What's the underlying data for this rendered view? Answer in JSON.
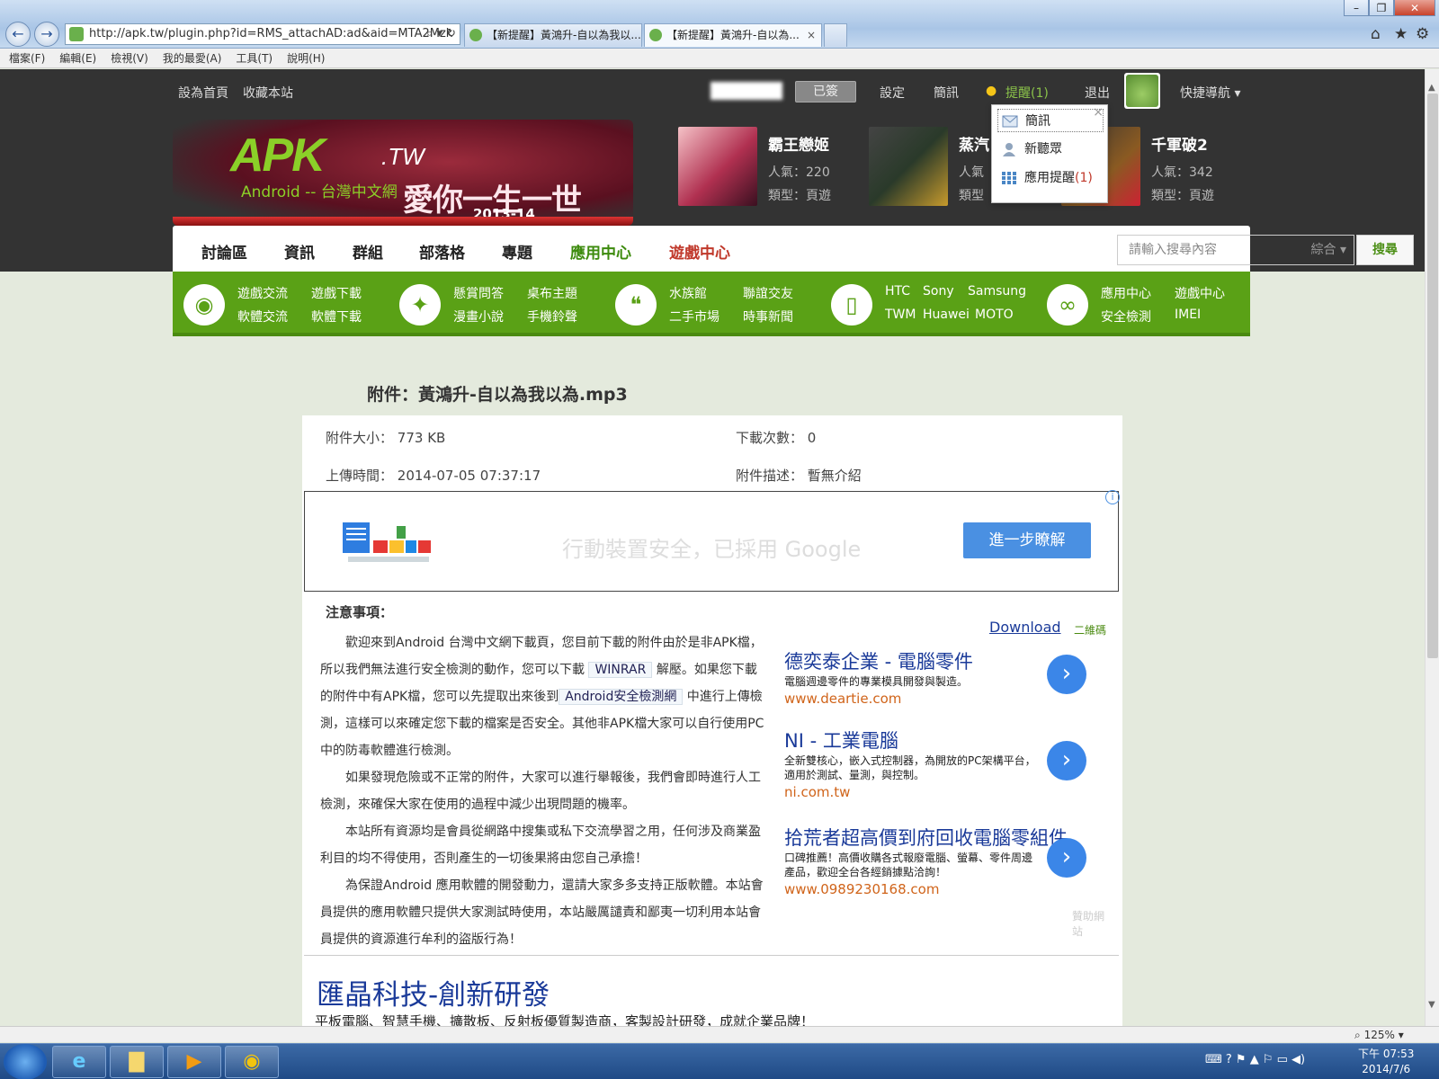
{
  "browser": {
    "url": "http://apk.tw/plugin.php?id=RMS_attachAD:ad&aid=MTA2Mzk",
    "tabs": [
      {
        "label": "【新提醒】黃鴻升-自以為我以..."
      },
      {
        "label": "【新提醒】黃鴻升-自以為..."
      }
    ],
    "tab_close": "×",
    "menu": [
      "檔案(F)",
      "編輯(E)",
      "檢視(V)",
      "我的最愛(A)",
      "工具(T)",
      "說明(H)"
    ],
    "zoom": "125%"
  },
  "topbar": {
    "set_home": "設為首頁",
    "bookmark": "收藏本站",
    "signed": "已簽",
    "settings": "設定",
    "messages": "簡訊",
    "remind": "提醒(1)",
    "logout": "退出",
    "quick_nav": "快捷導航"
  },
  "dropdown": {
    "items": [
      {
        "label": "簡訊",
        "icon": "mail-icon"
      },
      {
        "label": "新聽眾",
        "icon": "user-icon"
      },
      {
        "label": "應用提醒",
        "count": "(1)",
        "icon": "grid-icon"
      }
    ],
    "close": "×"
  },
  "logo": {
    "apk": "APK",
    "tw": ".TW",
    "sub": "Android -- 台灣中文網",
    "love": "愛你一生一世",
    "year": "2013-14"
  },
  "games": [
    {
      "name": "霸王戀姬",
      "popularity": "人氣：220",
      "type": "類型：頁遊"
    },
    {
      "name": "蒸汽",
      "popularity": "人氣",
      "type": "類型"
    },
    {
      "name": "千軍破2",
      "popularity": "人氣：342",
      "type": "類型：頁遊"
    }
  ],
  "mainnav": {
    "items": [
      "討論區",
      "資訊",
      "群組",
      "部落格",
      "專題",
      "應用中心",
      "遊戲中心"
    ],
    "search_placeholder": "請輸入搜尋內容",
    "search_scope": "綜合",
    "search_button": "搜尋"
  },
  "catbar": {
    "groups": [
      {
        "icon": "android-icon",
        "links": [
          "遊戲交流",
          "遊戲下載",
          "軟體交流",
          "軟體下載"
        ]
      },
      {
        "icon": "wand-icon",
        "links": [
          "懸賞問答",
          "桌布主題",
          "漫畫小說",
          "手機鈴聲"
        ]
      },
      {
        "icon": "chat-icon",
        "links": [
          "水族館",
          "聯誼交友",
          "二手市場",
          "時事新聞"
        ]
      },
      {
        "icon": "phone-icon",
        "links": [
          "HTC",
          "Sony",
          "Samsung",
          "TWM",
          "Huawei",
          "MOTO"
        ]
      },
      {
        "icon": "link-icon",
        "links": [
          "應用中心",
          "遊戲中心",
          "安全檢測",
          "IMEI"
        ]
      }
    ]
  },
  "attachment": {
    "title": "附件：黃鴻升-自以為我以為.mp3",
    "size_label": "附件大小：",
    "size": "773 KB",
    "downloads_label": "下載次數：",
    "downloads": "0",
    "upload_label": "上傳時間：",
    "upload_time": "2014-07-05 07:37:17",
    "desc_label": "附件描述：",
    "desc": "暫無介紹"
  },
  "banner": {
    "text": "行動裝置安全，已採用 Google",
    "button": "進一步瞭解",
    "info": "i"
  },
  "notice": {
    "title": "注意事項：",
    "p1_a": "歡迎來到Android 台灣中文網下載頁，您目前下載的附件由於是非APK檔，所以我們無法進行安全檢測的動作，您可以下載",
    "p1_link1": "WINRAR",
    "p1_b": "解壓。如果您下載的附件中有APK檔，您可以先提取出來後到",
    "p1_link2": "Android安全檢測網",
    "p1_c": "中進行上傳檢測，這樣可以來確定您下載的檔案是否安全。其他非APK檔大家可以自行使用PC中的防毒軟體進行檢測。",
    "p2": "如果發現危險或不正常的附件，大家可以進行舉報後，我們會即時進行人工檢測，來確保大家在使用的過程中減少出現問題的機率。",
    "p3": "本站所有資源均是會員從網路中搜集或私下交流學習之用，任何涉及商業盈利目的均不得使用，否則產生的一切後果將由您自己承擔！",
    "p4": "為保證Android 應用軟體的開發動力，還請大家多多支持正版軟體。本站會員提供的應用軟體只提供大家測試時使用，本站嚴厲譴責和鄙夷一切利用本站會員提供的資源進行牟利的盜版行為！"
  },
  "ads": {
    "download": "Download",
    "qr": "二維碼",
    "items": [
      {
        "title": "德奕泰企業 - 電腦零件",
        "desc": "電腦週邊零件的專業模具開發與製造。",
        "url": "www.deartie.com"
      },
      {
        "title": "NI - 工業電腦",
        "desc": "全新雙核心，嵌入式控制器，為開放的PC架構平台，適用於測試、量測，與控制。",
        "url": "ni.com.tw"
      },
      {
        "title": "拾荒者超高價到府回收電腦零組件",
        "desc": "口碑推薦！高價收購各式報廢電腦、螢幕、零件周邊產品，歡迎全台各經銷據點洽詢！",
        "url": "www.0989230168.com"
      }
    ],
    "sponsor": "贊助網站",
    "arrow": "›"
  },
  "bottom_ad": {
    "title": "匯晶科技-創新研發",
    "desc": "平板電腦、智慧手機、擴散板、反射板優質製造商，客製設計研發，成就企業品牌！"
  },
  "clock": {
    "time": "下午 07:53",
    "date": "2014/7/6"
  },
  "colors": {
    "green": "#5aa116",
    "dark": "#333333",
    "link": "#1a3a99",
    "accent_red": "#c0392b"
  }
}
